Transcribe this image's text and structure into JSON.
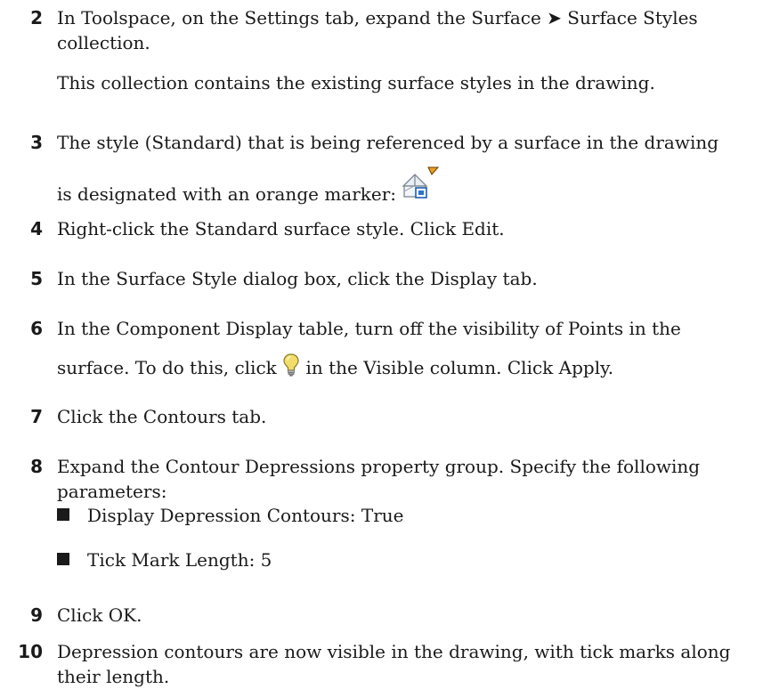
{
  "steps": [
    {
      "num": "2",
      "line1": "In Toolspace, on the Settings tab, expand the Surface ➤ Surface Styles",
      "line2": "collection.",
      "sub": "This collection contains the existing surface styles in the drawing."
    },
    {
      "num": "3",
      "line1": "The style (Standard) that is being referenced by a surface in the drawing",
      "line2": "is designated with an orange marker:"
    },
    {
      "num": "4",
      "text": "Right-click the Standard surface style. Click Edit."
    },
    {
      "num": "5",
      "text": "In the Surface Style dialog box, click the Display tab."
    },
    {
      "num": "6",
      "line1": "In the Component Display table, turn off the visibility of Points in the",
      "line2_pre": "surface. To do this, click",
      "line2_post": "in the Visible column. Click Apply."
    },
    {
      "num": "7",
      "text": "Click the Contours tab."
    },
    {
      "num": "8",
      "line1": "Expand the Contour Depressions property group. Specify the following",
      "line2": "parameters:",
      "bullets": [
        "Display Depression Contours: True",
        "Tick Mark Length: 5"
      ]
    },
    {
      "num": "9",
      "text": "Click OK."
    },
    {
      "num": "10",
      "line1": "Depression contours are now visible in the drawing, with tick marks along",
      "line2": "their length."
    }
  ],
  "icons": {
    "marker": "surface-style-orange-marker-icon",
    "visible": "lightbulb-icon"
  },
  "colors": {
    "marker_orange": "#e8a020",
    "bulb_yellow": "#f2dc6a"
  }
}
